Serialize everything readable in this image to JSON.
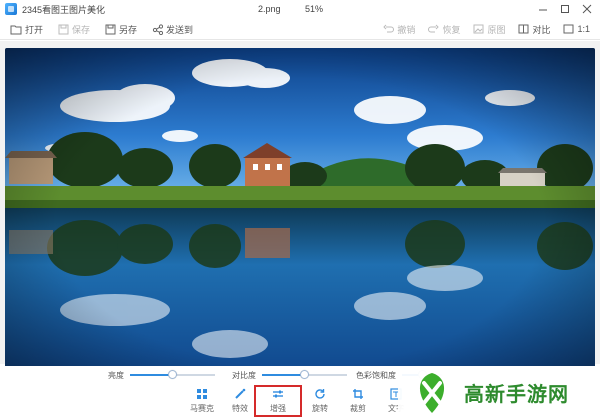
{
  "window": {
    "app_title": "2345看图王图片美化",
    "doc_name": "2.png",
    "doc_zoom": "51%"
  },
  "toolbar": {
    "left": [
      {
        "label": "打开",
        "icon": "folder-open-icon",
        "enabled": true
      },
      {
        "label": "保存",
        "icon": "save-icon",
        "enabled": false
      },
      {
        "label": "另存",
        "icon": "save-as-icon",
        "enabled": true
      },
      {
        "label": "发送到",
        "icon": "share-icon",
        "enabled": true
      }
    ],
    "right": [
      {
        "label": "撤销",
        "icon": "undo-icon",
        "enabled": false
      },
      {
        "label": "恢复",
        "icon": "redo-icon",
        "enabled": false
      },
      {
        "label": "原图",
        "icon": "original-image-icon",
        "enabled": false
      },
      {
        "label": "对比",
        "icon": "compare-icon",
        "enabled": true
      },
      {
        "label": "1:1",
        "icon": "actual-size-icon",
        "enabled": true
      }
    ]
  },
  "adjustments": [
    {
      "label": "亮度",
      "value": 0.5
    },
    {
      "label": "对比度",
      "value": 0.5
    },
    {
      "label": "色彩饱和度",
      "value": 0.5
    }
  ],
  "bottom_tools": [
    {
      "label": "马赛克",
      "icon": "mosaic-icon",
      "active": false
    },
    {
      "label": "特效",
      "icon": "magic-wand-icon",
      "active": false
    },
    {
      "label": "增强",
      "icon": "sliders-icon",
      "active": true
    },
    {
      "label": "旋转",
      "icon": "rotate-icon",
      "active": false
    },
    {
      "label": "裁剪",
      "icon": "crop-icon",
      "active": false
    },
    {
      "label": "文字",
      "icon": "text-icon",
      "active": false
    }
  ],
  "watermark": {
    "text": "高新手游网"
  },
  "colors": {
    "accent": "#2f8ce0",
    "active_border": "#d52a2a",
    "watermark_green": "#2e8b2e"
  }
}
